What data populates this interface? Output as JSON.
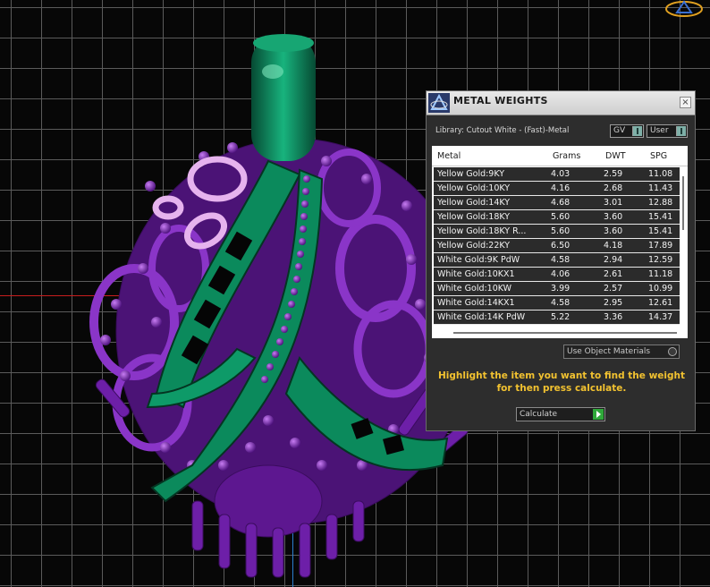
{
  "dialog": {
    "title": "METAL WEIGHTS",
    "close_glyph": "×",
    "library": "Library: Cutout White - (Fast)-Metal",
    "gv_label": "GV",
    "user_label": "User",
    "columns": [
      "Metal",
      "Grams",
      "DWT",
      "SPG"
    ],
    "rows": [
      {
        "metal": "Yellow Gold:9KY",
        "grams": "4.03",
        "dwt": "2.59",
        "spg": "11.08"
      },
      {
        "metal": "Yellow Gold:10KY",
        "grams": "4.16",
        "dwt": "2.68",
        "spg": "11.43"
      },
      {
        "metal": "Yellow Gold:14KY",
        "grams": "4.68",
        "dwt": "3.01",
        "spg": "12.88"
      },
      {
        "metal": "Yellow Gold:18KY",
        "grams": "5.60",
        "dwt": "3.60",
        "spg": "15.41"
      },
      {
        "metal": "Yellow Gold:18KY R...",
        "grams": "5.60",
        "dwt": "3.60",
        "spg": "15.41"
      },
      {
        "metal": "Yellow Gold:22KY",
        "grams": "6.50",
        "dwt": "4.18",
        "spg": "17.89"
      },
      {
        "metal": "White Gold:9K PdW",
        "grams": "4.58",
        "dwt": "2.94",
        "spg": "12.59"
      },
      {
        "metal": "White Gold:10KX1",
        "grams": "4.06",
        "dwt": "2.61",
        "spg": "11.18"
      },
      {
        "metal": "White Gold:10KW",
        "grams": "3.99",
        "dwt": "2.57",
        "spg": "10.99"
      },
      {
        "metal": "White Gold:14KX1",
        "grams": "4.58",
        "dwt": "2.95",
        "spg": "12.61"
      },
      {
        "metal": "White Gold:14K PdW",
        "grams": "5.22",
        "dwt": "3.36",
        "spg": "14.37"
      }
    ],
    "use_object_materials": "Use Object Materials",
    "hint": "Highlight the item you want to find the weight for then press calculate.",
    "calculate_label": "Calculate"
  },
  "colors": {
    "metal_green": "#0b8a5c",
    "gem_purple": "#7a24b8",
    "highlight_pink": "#e6b3ee",
    "hint_yellow": "#f2c230",
    "calc_green": "#2fa83a"
  },
  "icons": {
    "app": "app-logo-icon",
    "close": "close-icon",
    "nav": "nav-cube-icon",
    "calculate": "play-arrow-icon"
  }
}
